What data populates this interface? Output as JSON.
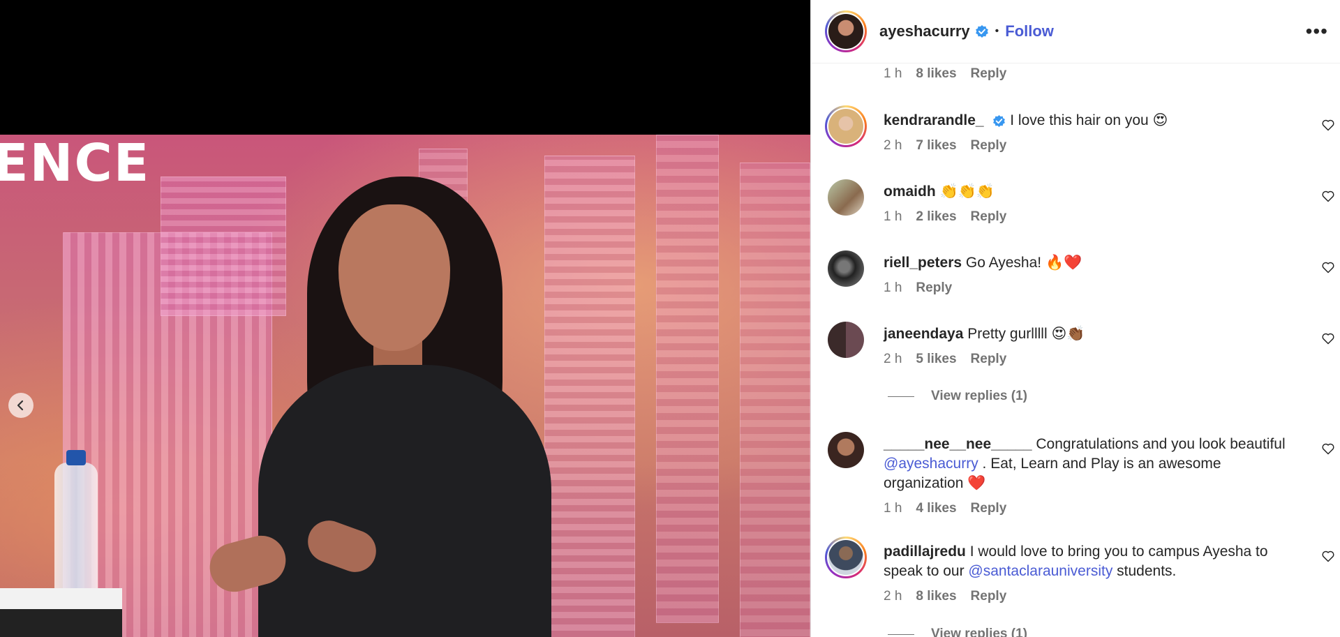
{
  "post": {
    "username": "ayeshacurry",
    "follow_label": "Follow",
    "dot": "•",
    "more_label": "•••",
    "sign_text": "ENCE"
  },
  "comments": {
    "top_meta": {
      "time": "1 h",
      "likes": "8 likes",
      "reply": "Reply"
    },
    "items": [
      {
        "username": "kendrarandle_",
        "verified": true,
        "text": "I love this hair on you 😍",
        "mentions": [],
        "time": "2 h",
        "likes": "7 likes",
        "reply": "Reply",
        "ring": true
      },
      {
        "username": "omaidh",
        "verified": false,
        "text": "👏👏👏",
        "time": "1 h",
        "likes": "2 likes",
        "reply": "Reply",
        "ring": false
      },
      {
        "username": "riell_peters",
        "verified": false,
        "text": "Go Ayesha! 🔥❤️",
        "time": "1 h",
        "likes": "",
        "reply": "Reply",
        "ring": false
      },
      {
        "username": "janeendaya",
        "verified": false,
        "text": "Pretty gurlllll 😍👏🏾",
        "time": "2 h",
        "likes": "5 likes",
        "reply": "Reply",
        "ring": false,
        "view_replies": "View replies (1)"
      },
      {
        "username": "_____nee__nee_____",
        "verified": false,
        "text_before": "Congratulations and you look beautiful",
        "mention": "@ayeshacurry",
        "text_after": ". Eat, Learn and Play is an awesome organization ❤️",
        "time": "1 h",
        "likes": "4 likes",
        "reply": "Reply",
        "ring": false
      },
      {
        "username": "padillajredu",
        "verified": false,
        "text_before": "I would love to bring you to campus Ayesha to speak to our",
        "mention": "@santaclarauniversity",
        "text_after": "students.",
        "time": "2 h",
        "likes": "8 likes",
        "reply": "Reply",
        "ring": true,
        "view_replies": "View replies (1)"
      }
    ]
  },
  "icons": {
    "verified": "verified-badge-icon",
    "heart": "heart-outline-icon",
    "prev": "chevron-left-icon",
    "more": "more-options-icon"
  },
  "colors": {
    "link": "#4a5bd4",
    "verified": "#3897f0",
    "meta": "#737373",
    "text": "#262626"
  }
}
